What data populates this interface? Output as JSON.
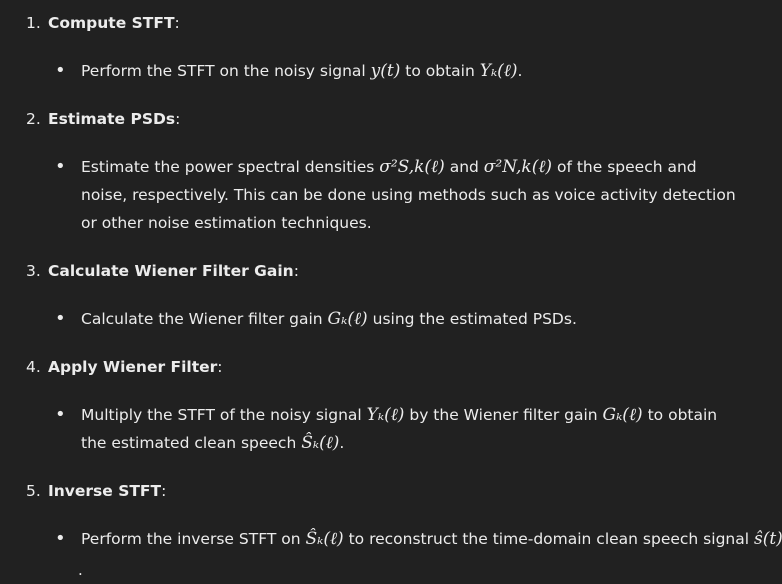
{
  "steps": [
    {
      "num": "1.",
      "title": "Compute STFT",
      "colon": ":",
      "bullet": {
        "t1": "Perform the STFT on the noisy signal ",
        "m1": "y(t)",
        "t2": " to obtain ",
        "m2": "Yₖ(ℓ)",
        "t3": "."
      }
    },
    {
      "num": "2.",
      "title": "Estimate PSDs",
      "colon": ":",
      "bullet": {
        "t1": "Estimate the power spectral densities ",
        "m1": "σ²S,k(ℓ)",
        "t2": " and ",
        "m2": "σ²N,k(ℓ)",
        "t3": " of the speech and noise, respectively. This can be done using methods such as voice activity detection or other noise estimation techniques."
      }
    },
    {
      "num": "3.",
      "title": "Calculate Wiener Filter Gain",
      "colon": ":",
      "bullet": {
        "t1": "Calculate the Wiener filter gain ",
        "m1": "Gₖ(ℓ)",
        "t2": " using the estimated PSDs."
      }
    },
    {
      "num": "4.",
      "title": "Apply Wiener Filter",
      "colon": ":",
      "bullet": {
        "t1": "Multiply the STFT of the noisy signal ",
        "m1": "Yₖ(ℓ)",
        "t2": " by the Wiener filter gain ",
        "m2": "Gₖ(ℓ)",
        "t3": " to obtain the estimated clean speech ",
        "m3": "Ŝₖ(ℓ)",
        "t4": "."
      }
    },
    {
      "num": "5.",
      "title": "Inverse STFT",
      "colon": ":",
      "bullet": {
        "t1": "Perform the inverse STFT on ",
        "m1": "Ŝₖ(ℓ)",
        "t2": " to reconstruct the time-domain clean speech signal ",
        "m2": "ŝ(t)",
        "t3": "."
      }
    }
  ],
  "bullet_glyph": "•"
}
